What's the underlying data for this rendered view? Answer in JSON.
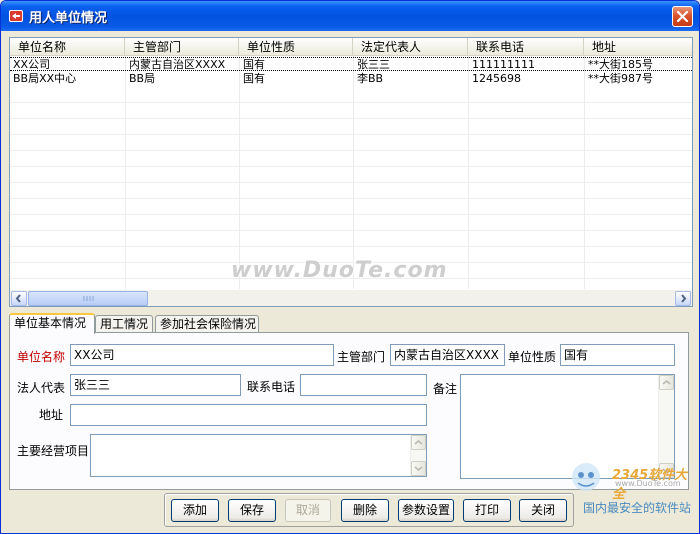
{
  "window": {
    "title": "用人单位情况"
  },
  "grid": {
    "columns": [
      "单位名称",
      "主管部门",
      "单位性质",
      "法定代表人",
      "联系电话",
      "地址"
    ],
    "rows": [
      [
        "XX公司",
        "内蒙古自治区XXXX",
        "国有",
        "张三三",
        "111111111",
        "**大街185号"
      ],
      [
        "BB局XX中心",
        "BB局",
        "国有",
        "李BB",
        "1245698",
        "**大街987号"
      ]
    ]
  },
  "watermark": "www.DuoTe.com",
  "tabs": [
    "单位基本情况",
    "用工情况",
    "参加社会保险情况"
  ],
  "form": {
    "unit_name_label": "单位名称",
    "unit_name_value": "XX公司",
    "dept_label": "主管部门",
    "dept_value": "内蒙古自治区XXXX",
    "nature_label": "单位性质",
    "nature_value": "国有",
    "rep_label": "法人代表",
    "rep_value": "张三三",
    "phone_label": "联系电话",
    "phone_value": "",
    "remark_label": "备注",
    "address_label": "地址",
    "address_value": "",
    "business_label": "主要经营项目"
  },
  "buttons": {
    "add": "添加",
    "save": "保存",
    "cancel": "取消",
    "delete": "删除",
    "settings": "参数设置",
    "print": "打印",
    "close": "关闭"
  },
  "corner_watermark": {
    "brand": "2345软件大全",
    "url": "www.DuoTe.com",
    "slogan": "国内最安全的软件站"
  },
  "colors": {
    "title_bar": "#0252e0",
    "required_label": "#c00000",
    "tab_highlight": "#ffc83c"
  }
}
